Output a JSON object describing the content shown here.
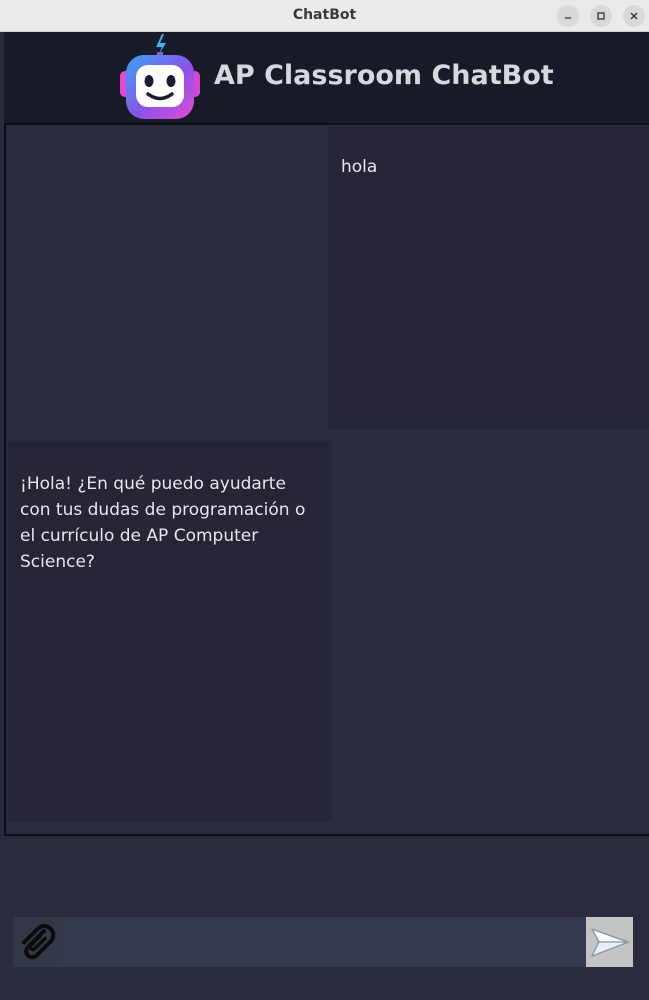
{
  "window": {
    "title": "ChatBot",
    "controls": [
      "minimize",
      "maximize",
      "close"
    ]
  },
  "header": {
    "title": "AP Classroom ChatBot",
    "logo_icon": "robot-icon"
  },
  "messages": [
    {
      "role": "user",
      "text": "hola"
    },
    {
      "role": "bot",
      "text": "¡Hola! ¿En qué puedo ayudarte con tus dudas de programación o el currículo de AP Computer Science?"
    }
  ],
  "input": {
    "value": "",
    "placeholder": "",
    "attach_icon": "paperclip-icon",
    "send_icon": "paper-plane-icon"
  },
  "colors": {
    "background": "#2a2b3d",
    "header_bg": "#161b27",
    "message_bg": "#252536",
    "input_bg": "#333a4f",
    "send_bg": "#c4c4c4",
    "text": "#e6e6ec"
  }
}
